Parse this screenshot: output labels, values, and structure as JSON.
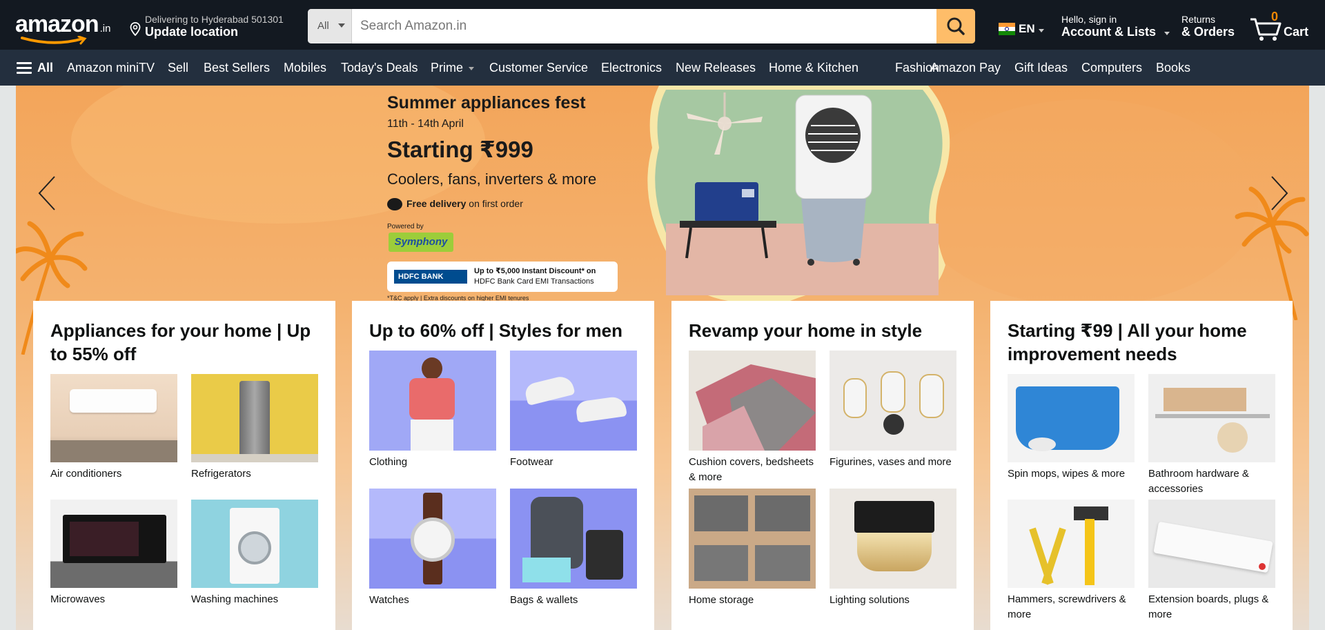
{
  "header": {
    "logo_text": "amazon",
    "logo_suffix": ".in",
    "deliver_line1": "Delivering to Hyderabad 501301",
    "deliver_line2": "Update location",
    "search_category": "All",
    "search_placeholder": "Search Amazon.in",
    "language": "EN",
    "account_line1": "Hello, sign in",
    "account_line2": "Account & Lists",
    "returns_line1": "Returns",
    "returns_line2": "& Orders",
    "cart_count": "0",
    "cart_label": "Cart"
  },
  "subnav": {
    "all_label": "All",
    "items": [
      "Amazon miniTV",
      "Sell",
      "Best Sellers",
      "Mobiles",
      "Today's Deals",
      "Prime",
      "Customer Service",
      "Electronics",
      "New Releases",
      "Home & Kitchen",
      "Fashion",
      "Amazon Pay",
      "Gift Ideas",
      "Computers",
      "Books"
    ]
  },
  "hero": {
    "title": "Summer appliances fest",
    "dates": "11th - 14th April",
    "starting": "Starting ₹999",
    "subtitle": "Coolers, fans, inverters & more",
    "delivery_bold": "Free delivery",
    "delivery_rest": " on first order",
    "powered_by": "Powered by",
    "brand": "Symphony",
    "bank": "HDFC BANK",
    "bank_offer_line1": "Up to ₹5,000 Instant Discount* on",
    "bank_offer_line2": "HDFC Bank Card EMI Transactions",
    "tc": "*T&C apply | Extra discounts on higher EMI tenures"
  },
  "cards": [
    {
      "title": "Appliances for your home | Up to 55% off",
      "tiles": [
        {
          "caption": "Air conditioners"
        },
        {
          "caption": "Refrigerators"
        },
        {
          "caption": "Microwaves"
        },
        {
          "caption": "Washing machines"
        }
      ]
    },
    {
      "title": "Up to 60% off | Styles for men",
      "tiles": [
        {
          "caption": "Clothing"
        },
        {
          "caption": "Footwear"
        },
        {
          "caption": "Watches"
        },
        {
          "caption": "Bags & wallets"
        }
      ]
    },
    {
      "title": "Revamp your home in style",
      "tiles": [
        {
          "caption": "Cushion covers, bedsheets & more"
        },
        {
          "caption": "Figurines, vases and more"
        },
        {
          "caption": "Home storage"
        },
        {
          "caption": "Lighting solutions"
        }
      ]
    },
    {
      "title": "Starting ₹99 | All your home improvement needs",
      "tiles": [
        {
          "caption": "Spin mops, wipes & more"
        },
        {
          "caption": "Bathroom hardware & accessories"
        },
        {
          "caption": "Hammers, screwdrivers & more"
        },
        {
          "caption": "Extension boards, plugs & more"
        }
      ]
    }
  ],
  "colors": {
    "nav_top": "#131921",
    "nav_sub": "#232f3e",
    "search_button": "#febd69",
    "cart_count": "#f08804",
    "hero_orange": "#f3a55a"
  }
}
